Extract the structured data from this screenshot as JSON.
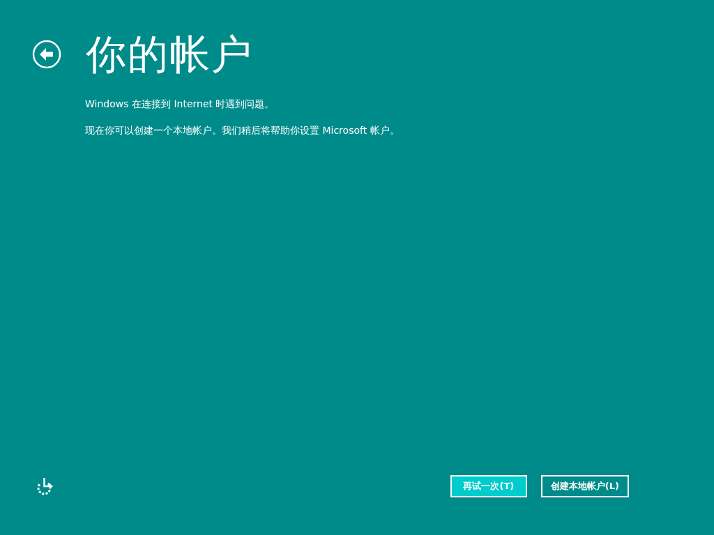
{
  "header": {
    "title": "你的帐户"
  },
  "messages": [
    "Windows 在连接到 Internet 时遇到问题。",
    "现在你可以创建一个本地帐户。我们稍后将帮助你设置 Microsoft 帐户。"
  ],
  "buttons": [
    {
      "label": "再试一次(T)",
      "selected": true
    },
    {
      "label": "创建本地帐户(L)",
      "selected": false
    }
  ]
}
